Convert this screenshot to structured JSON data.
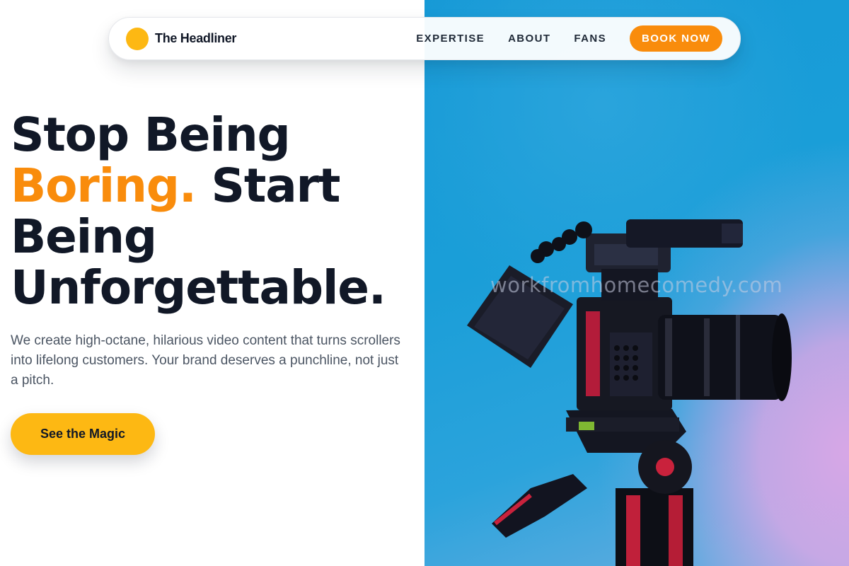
{
  "nav": {
    "brand": "The Headliner",
    "links": [
      "EXPERTISE",
      "ABOUT",
      "FANS"
    ],
    "cta": "BOOK NOW"
  },
  "hero": {
    "headline_part1": "Stop Being",
    "headline_accent": "Boring.",
    "headline_part2": "Start Being Unforgettable.",
    "subtext": "We create high-octane, hilarious video content that turns scrollers into lifelong customers. Your brand deserves a punchline, not just a pitch.",
    "cta": "See the Magic",
    "image_watermark": "workfromhomecomedy.com",
    "image_subject": "camera-on-tripod"
  },
  "colors": {
    "accent_orange": "#f98c0c",
    "accent_yellow": "#fdb813",
    "text_dark": "#111827",
    "photo_blue": "#1699d6",
    "photo_pink": "#d7a7e6"
  }
}
